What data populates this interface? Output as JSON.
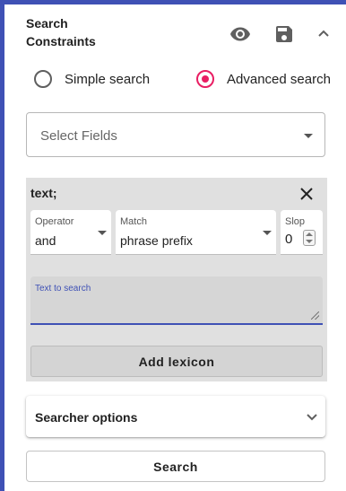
{
  "header": {
    "title": "Search Constraints",
    "icons": [
      "eye-icon",
      "save-icon",
      "chevron-up-icon"
    ]
  },
  "mode": {
    "options": [
      {
        "label": "Simple search",
        "selected": false
      },
      {
        "label": "Advanced search",
        "selected": true
      }
    ],
    "accent": "#e91e63"
  },
  "fields_select": {
    "placeholder": "Select Fields"
  },
  "group": {
    "title": "text;",
    "operator": {
      "label": "Operator",
      "value": "and"
    },
    "match": {
      "label": "Match",
      "value": "phrase prefix"
    },
    "slop": {
      "label": "Slop",
      "value": "0"
    },
    "text_input": {
      "label": "Text to search",
      "value": ""
    },
    "add_lexicon_label": "Add lexicon"
  },
  "searcher_options": {
    "label": "Searcher options"
  },
  "search_button": {
    "label": "Search"
  },
  "colors": {
    "primary": "#3f51b5",
    "group_bg": "#e0e0e0"
  }
}
